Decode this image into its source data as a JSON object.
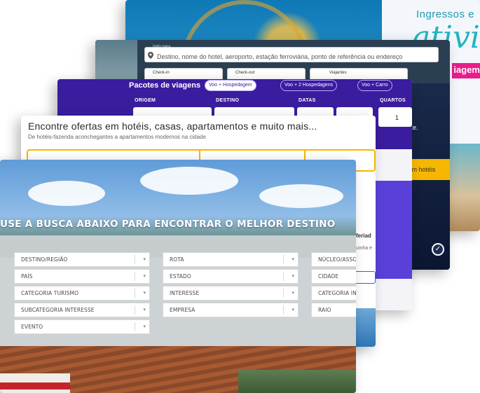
{
  "card1": {
    "title": "Ingressos e",
    "script": "ativi",
    "pink": "iagem"
  },
  "card2": {
    "dest_label": "Indo para",
    "dest_placeholder": "Destino, nome do hotel, aeroporto, estação ferroviária, ponto de referência ou endereço",
    "checkin_label": "Check-in",
    "checkout_label": "Check-out",
    "travelers_label": "Viajantes",
    "side_text": "ortante.",
    "yellow_text": "nal em hotéis"
  },
  "card3": {
    "title": "Pacotes de viagens",
    "pills": [
      {
        "label": "Voo + Hospedagem",
        "active": true
      },
      {
        "label": "Voo + 2 Hospedagens",
        "active": false
      },
      {
        "label": "Voo + Carro",
        "active": false
      }
    ],
    "origin_label": "ORIGEM",
    "destination_label": "DESTINO",
    "dates_label": "DATAS",
    "rooms_label": "QUARTOS",
    "rooms_value": "1"
  },
  "card4": {
    "title": "Encontre ofertas em hotéis, casas, apartamentos e muito mais...",
    "subtitle": "De hotéis-fazenda aconchegantes a apartamentos modernos na cidade",
    "side_title": "feriad",
    "side_sub": "uinha e"
  },
  "card5": {
    "banner": "USE A BUSCA ABAIXO PARA ENCONTRAR O MELHOR DESTINO",
    "fields_col1": [
      "DESTINO/REGIÃO",
      "PAÍS",
      "CATEGORIA TURISMO",
      "SUBCATEGORIA INTERESSE",
      "EVENTO"
    ],
    "fields_col2": [
      "ROTA",
      "ESTADO",
      "INTERESSE",
      "EMPRESA"
    ],
    "fields_col3": [
      "NÚCLEO/ASSOCIAÇÃO",
      "CIDADE",
      "CATEGORIA INTERESSE",
      "RAIO"
    ]
  },
  "colors": {
    "purple": "#3a1c9e",
    "yellow": "#f5b700",
    "pink": "#e81d8a",
    "navy": "#2b3f52"
  }
}
